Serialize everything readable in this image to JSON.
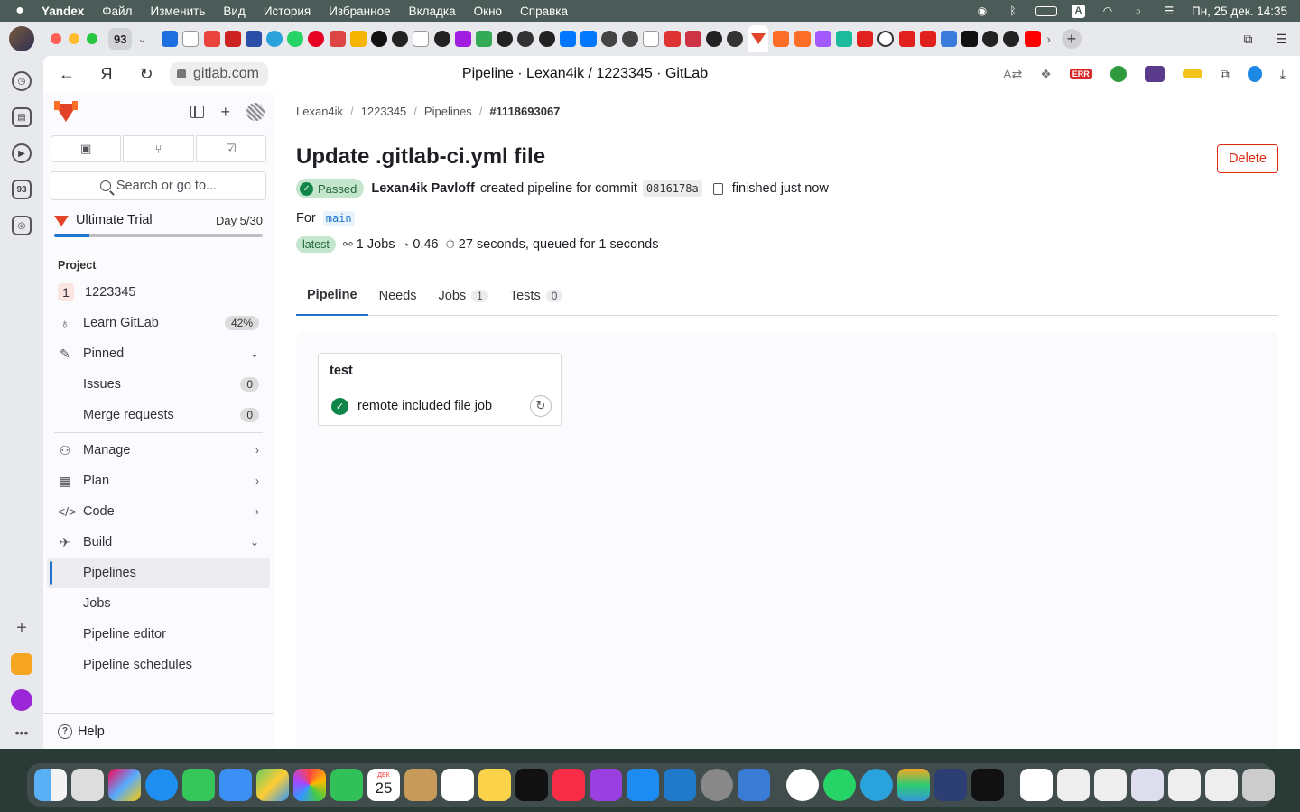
{
  "menubar": {
    "items": [
      "Yandex",
      "Файл",
      "Изменить",
      "Вид",
      "История",
      "Избранное",
      "Вкладка",
      "Окно",
      "Справка"
    ],
    "datetime": "Пн, 25 дек.  14:35",
    "input_source": "A"
  },
  "browser": {
    "tab_count": "93",
    "url": "gitlab.com",
    "page_title": "Pipeline · Lexan4ik / 1223345 · GitLab",
    "ext_err": "ERR",
    "sidebar_counter": "93"
  },
  "sidebar": {
    "search_placeholder": "Search or go to...",
    "trial": {
      "label": "Ultimate Trial",
      "day": "Day 5/30",
      "progress_fraction": 0.167
    },
    "section_title": "Project",
    "project": {
      "avatar_letter": "1",
      "name": "1223345"
    },
    "learn": {
      "label": "Learn GitLab",
      "badge": "42%"
    },
    "pinned": {
      "label": "Pinned",
      "issues_label": "Issues",
      "issues_count": "0",
      "mr_label": "Merge requests",
      "mr_count": "0"
    },
    "groups": {
      "manage": "Manage",
      "plan": "Plan",
      "code": "Code",
      "build": "Build"
    },
    "build_items": {
      "pipelines": "Pipelines",
      "jobs": "Jobs",
      "editor": "Pipeline editor",
      "schedules": "Pipeline schedules"
    },
    "help": "Help"
  },
  "breadcrumb": {
    "owner": "Lexan4ik",
    "project": "1223345",
    "section": "Pipelines",
    "current": "#1118693067"
  },
  "pipeline": {
    "title": "Update .gitlab-ci.yml file",
    "delete_label": "Delete",
    "status": "Passed",
    "author": "Lexan4ik Pavloff",
    "created_text": "created pipeline for commit",
    "sha": "0816178a",
    "finished_text": "finished just now",
    "for_label": "For",
    "branch": "main",
    "latest_badge": "latest",
    "jobs_text": "1 Jobs",
    "score": "0.46",
    "duration_text": "27 seconds, queued for 1 seconds"
  },
  "tabs": [
    {
      "label": "Pipeline"
    },
    {
      "label": "Needs"
    },
    {
      "label": "Jobs",
      "count": "1"
    },
    {
      "label": "Tests",
      "count": "0"
    }
  ],
  "graph": {
    "stage": "test",
    "job": "remote included file job"
  },
  "dock": {
    "calendar_month": "ДЕК",
    "calendar_day": "25"
  }
}
